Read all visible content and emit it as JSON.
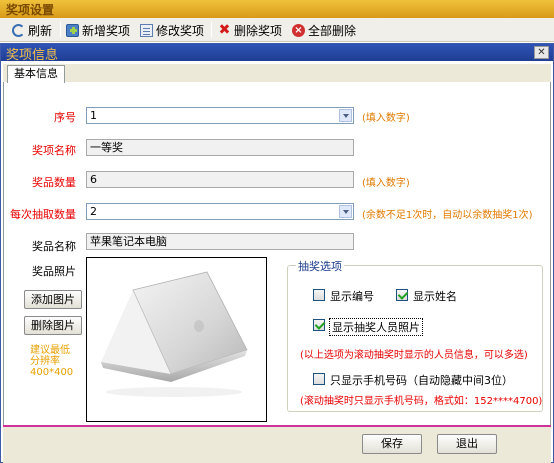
{
  "window": {
    "title": "奖项设置"
  },
  "toolbar": {
    "refresh": "刷新",
    "add": "新增奖项",
    "edit": "修改奖项",
    "delete": "删除奖项",
    "delete_all": "全部删除"
  },
  "dialog": {
    "title": "奖项信息",
    "close_glyph": "✕",
    "tab": "基本信息"
  },
  "form": {
    "seq_label": "序号",
    "seq_value": "1",
    "seq_hint": "(填入数字)",
    "name_label": "奖项名称",
    "name_value": "一等奖",
    "qty_label": "奖品数量",
    "qty_value": "6",
    "qty_hint": "(填入数字)",
    "draw_label": "每次抽取数量",
    "draw_value": "2",
    "draw_hint": "(余数不足1次时，自动以余数抽奖1次)",
    "prize_label": "奖品名称",
    "prize_value": "苹果笔记本电脑",
    "photo_label": "奖品照片",
    "add_photo": "添加图片",
    "del_photo": "删除图片",
    "resolution_note": [
      "建议最低",
      "分辨率",
      "400*400"
    ]
  },
  "options": {
    "legend": "抽奖选项",
    "show_number": {
      "label": "显示编号",
      "checked": false
    },
    "show_name": {
      "label": "显示姓名",
      "checked": true
    },
    "show_photo": {
      "label": "显示抽奖人员照片",
      "checked": true
    },
    "note1": "(以上选项为滚动抽奖时显示的人员信息，可以多选)",
    "phone_only": {
      "label": "只显示手机号码（自动隐藏中间3位）",
      "checked": false
    },
    "note2": "(滚动抽奖时只显示手机号码，格式如：152****4700)"
  },
  "footer": {
    "save": "保存",
    "exit": "退出"
  },
  "colors": {
    "accent_red": "#e60000",
    "hint_orange": "#e07a00",
    "title_blue": "#2f54b6"
  }
}
